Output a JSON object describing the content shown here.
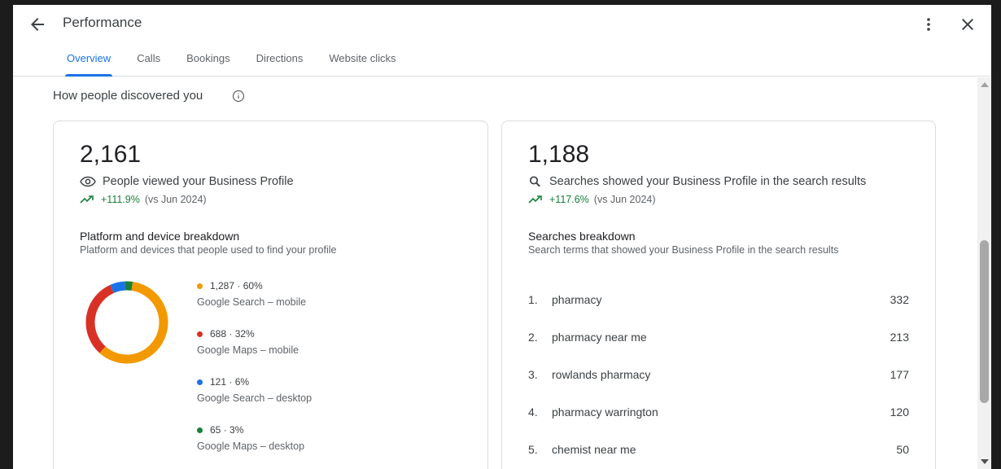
{
  "header": {
    "title": "Performance",
    "back_icon": "arrow-left-icon",
    "more_icon": "more-vert-icon",
    "close_icon": "close-icon"
  },
  "tabs": [
    {
      "label": "Overview",
      "active": true
    },
    {
      "label": "Calls",
      "active": false
    },
    {
      "label": "Bookings",
      "active": false
    },
    {
      "label": "Directions",
      "active": false
    },
    {
      "label": "Website clicks",
      "active": false
    }
  ],
  "section": {
    "title": "How people discovered you",
    "info_icon": "info-icon"
  },
  "views_card": {
    "total": "2,161",
    "icon": "eye-icon",
    "label": "People viewed your Business Profile",
    "trend_icon": "trending-up-icon",
    "trend_pct": "+111.9%",
    "trend_vs": "(vs Jun 2024)",
    "breakdown_title": "Platform and device breakdown",
    "breakdown_desc": "Platform and devices that people used to find your profile",
    "segments": [
      {
        "value": "1,287",
        "pct": "60%",
        "label": "Google Search – mobile",
        "color": "#f29900",
        "share": 60
      },
      {
        "value": "688",
        "pct": "32%",
        "label": "Google Maps – mobile",
        "color": "#d93025",
        "share": 32
      },
      {
        "value": "121",
        "pct": "6%",
        "label": "Google Search – desktop",
        "color": "#1a73e8",
        "share": 6
      },
      {
        "value": "65",
        "pct": "3%",
        "label": "Google Maps – desktop",
        "color": "#188038",
        "share": 3
      }
    ]
  },
  "searches_card": {
    "total": "1,188",
    "icon": "search-icon",
    "label": "Searches showed your Business Profile in the search results",
    "trend_icon": "trending-up-icon",
    "trend_pct": "+117.6%",
    "trend_vs": "(vs Jun 2024)",
    "breakdown_title": "Searches breakdown",
    "breakdown_desc": "Search terms that showed your Business Profile in the search results",
    "terms": [
      {
        "rank": "1.",
        "term": "pharmacy",
        "count": "332"
      },
      {
        "rank": "2.",
        "term": "pharmacy near me",
        "count": "213"
      },
      {
        "rank": "3.",
        "term": "rowlands pharmacy",
        "count": "177"
      },
      {
        "rank": "4.",
        "term": "pharmacy warrington",
        "count": "120"
      },
      {
        "rank": "5.",
        "term": "chemist near me",
        "count": "50"
      }
    ]
  }
}
